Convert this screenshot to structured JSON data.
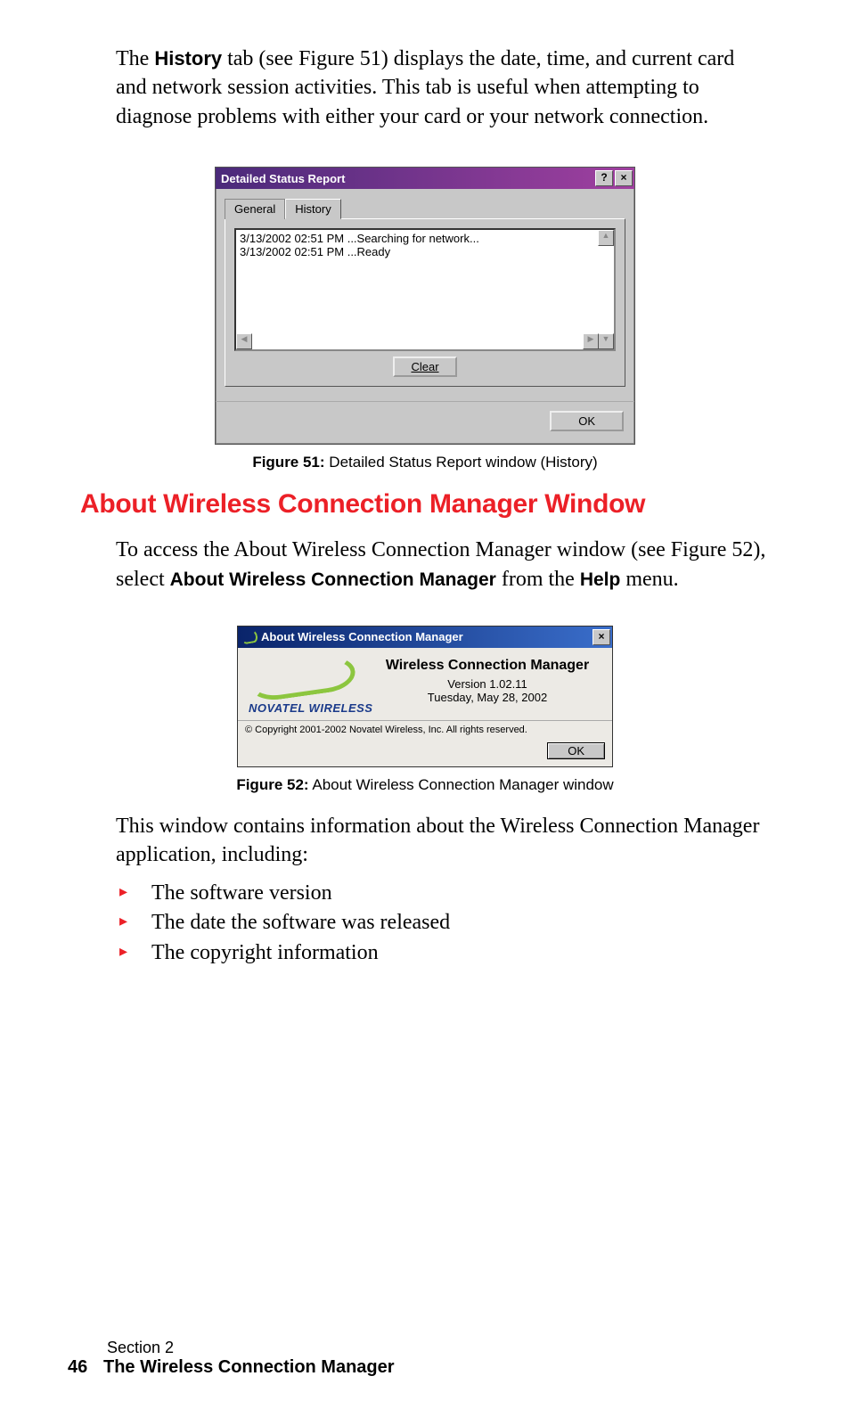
{
  "intro": {
    "prefix": "The ",
    "bold1": "History",
    "rest": " tab (see Figure 51) displays the date, time, and current card and network session activities. This tab is useful when attempting to diagnose problems with either your card or your network connection."
  },
  "fig51": {
    "title": "Detailed Status Report",
    "help_btn": "?",
    "close_btn": "×",
    "tab_general": "General",
    "tab_history": "History",
    "log1": "3/13/2002 02:51 PM ...Searching for network...",
    "log2": "3/13/2002 02:51 PM ...Ready",
    "clear_btn": "Clear",
    "ok_btn": "OK",
    "caption_bold": "Figure 51:",
    "caption_rest": " Detailed Status Report window (History)"
  },
  "heading": "About Wireless Connection Manager Window",
  "midpara": {
    "t1": "To access the About Wireless Connection Manager window (see Figure 52), select ",
    "b1": "About Wireless Connection Manager",
    "t2": " from the ",
    "b2": "Help",
    "t3": " menu."
  },
  "fig52": {
    "title": "About Wireless Connection Manager",
    "close_btn": "×",
    "brand": "NOVATEL WIRELESS",
    "appname": "Wireless Connection Manager",
    "version": "Version 1.02.11",
    "date": "Tuesday, May 28, 2002",
    "copyright": "© Copyright 2001-2002 Novatel Wireless, Inc.  All rights reserved.",
    "ok_btn": "OK",
    "caption_bold": "Figure 52:",
    "caption_rest": " About Wireless Connection Manager window"
  },
  "afterpara": "This window contains information about the Wireless Connection Manager application, including:",
  "bullets": {
    "b1": "The software version",
    "b2": "The date the software was released",
    "b3": "The copyright information"
  },
  "footer": {
    "section": "Section 2",
    "page": "46",
    "chapter": "The Wireless Connection Manager"
  }
}
